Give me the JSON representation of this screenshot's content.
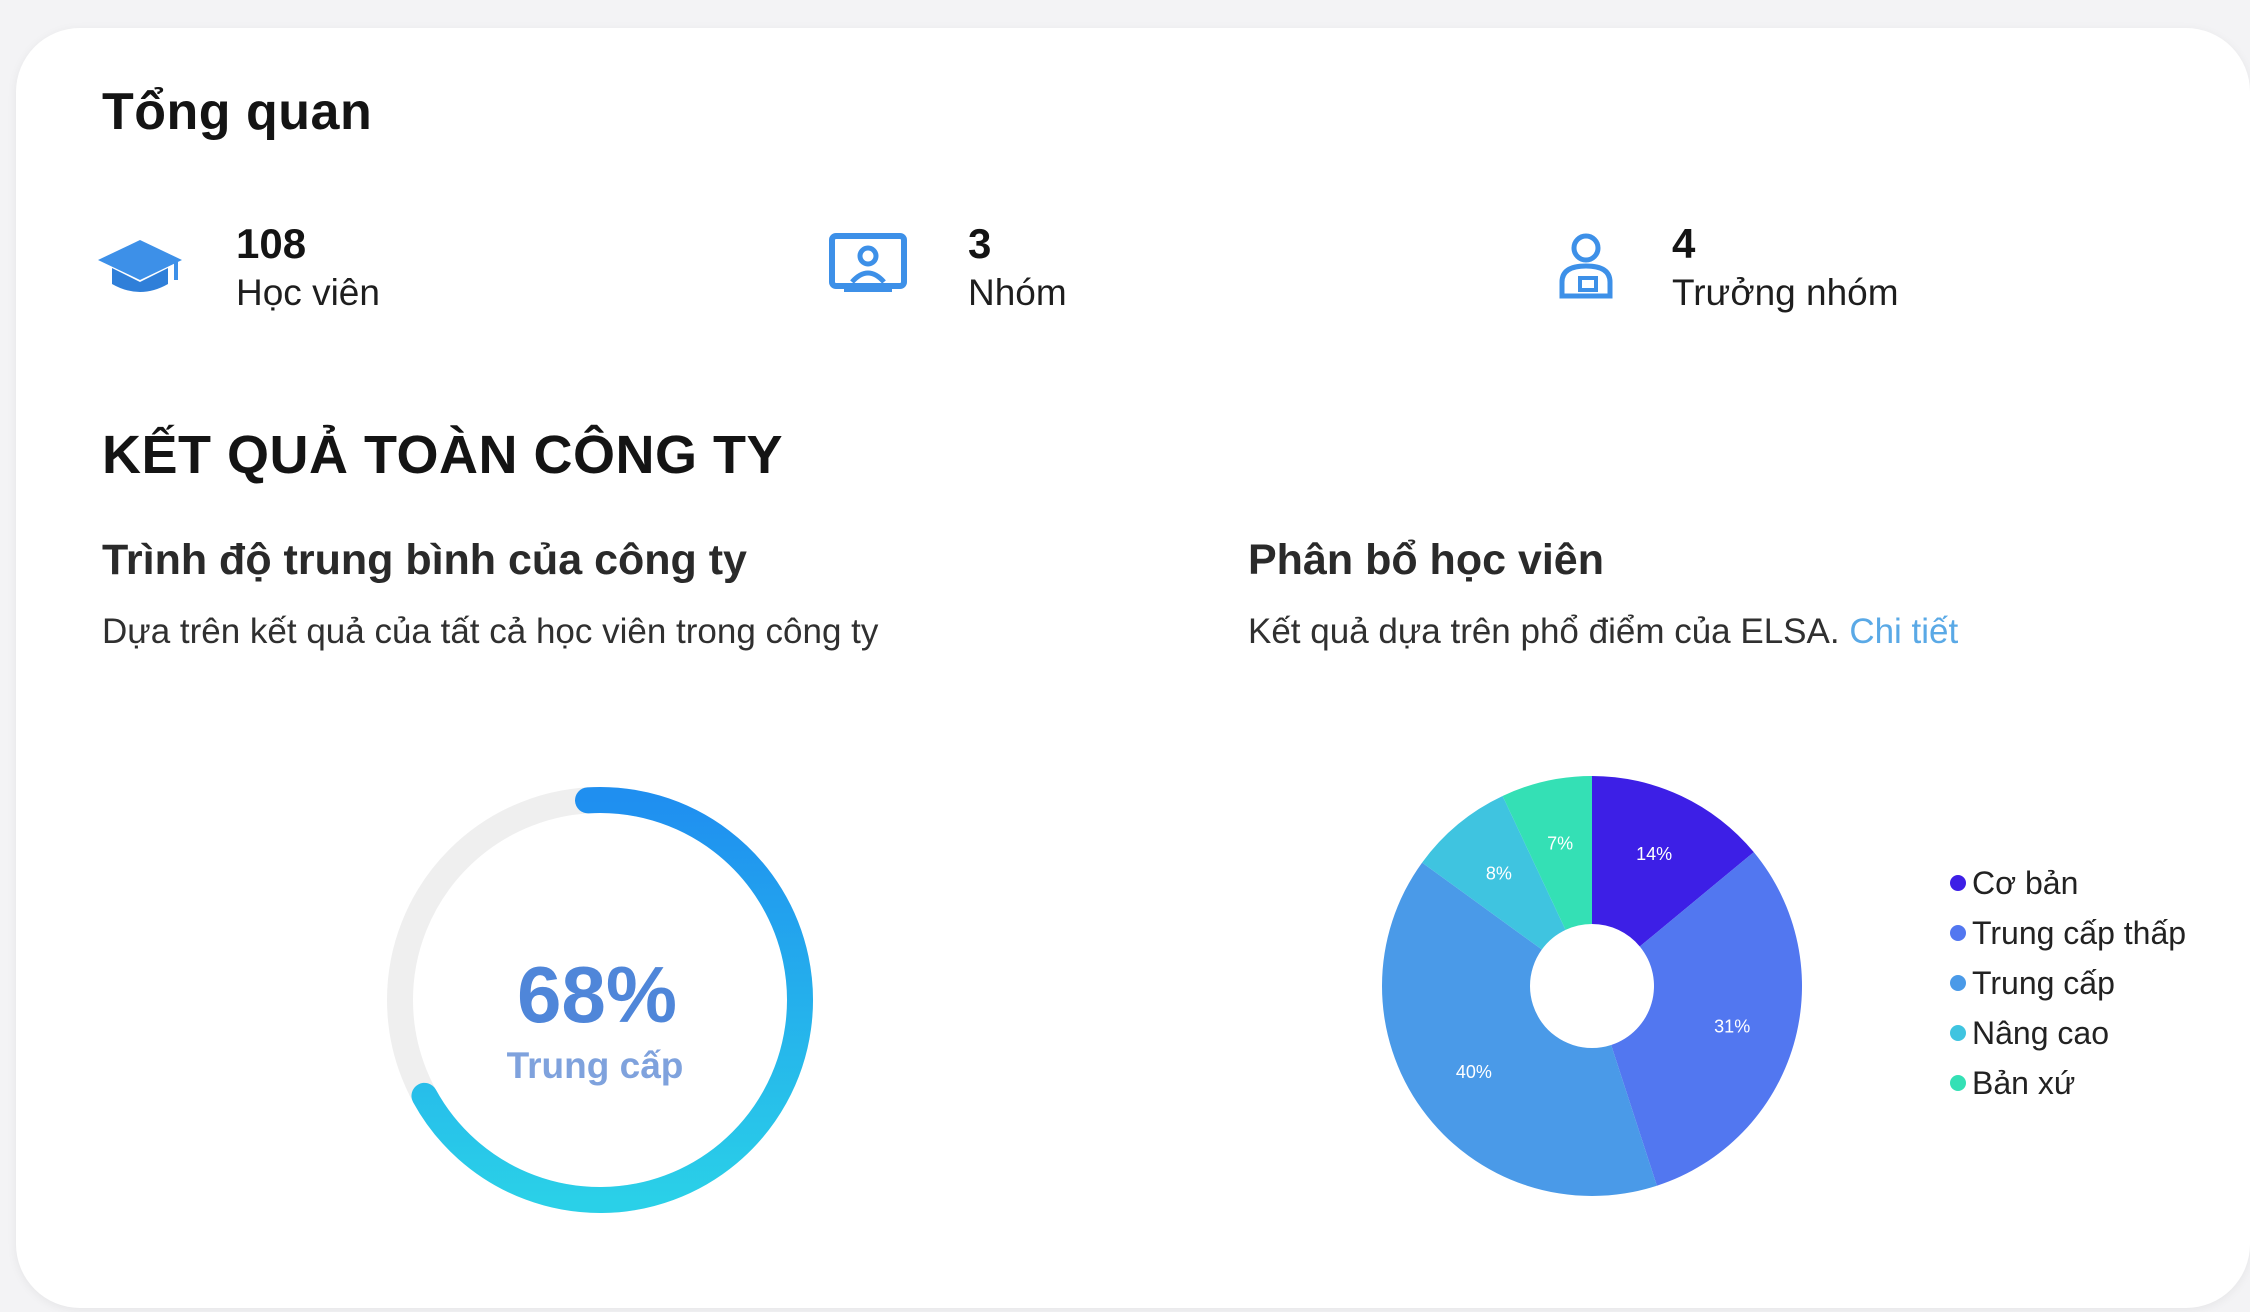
{
  "overview": {
    "title": "Tổng quan",
    "stats": [
      {
        "icon": "graduation-cap-icon",
        "value": "108",
        "label": "Học viên"
      },
      {
        "icon": "group-screen-icon",
        "value": "3",
        "label": "Nhóm"
      },
      {
        "icon": "team-leader-icon",
        "value": "4",
        "label": "Trưởng nhóm"
      }
    ]
  },
  "results": {
    "title": "KẾT QUẢ TOÀN CÔNG TY",
    "average": {
      "title": "Trình độ trung bình của công ty",
      "desc": "Dựa trên kết quả của tất cả học viên trong công ty",
      "percent_label": "68%",
      "percent": 68,
      "level": "Trung cấp"
    },
    "distribution": {
      "title": "Phân bổ học viên",
      "desc": "Kết quả dựa trên phổ điểm của ELSA. ",
      "link": "Chi tiết"
    }
  },
  "colors": {
    "accent": "#4f86d9",
    "gauge_start": "#2ad0e8",
    "gauge_end": "#1f8ff0",
    "gauge_track": "#efefef"
  },
  "chart_data": {
    "type": "pie",
    "categories": [
      "Cơ bản",
      "Trung cấp thấp",
      "Trung cấp",
      "Nâng cao",
      "Bản xứ"
    ],
    "values": [
      14,
      31,
      40,
      8,
      7
    ],
    "value_labels": [
      "14%",
      "31%",
      "40%",
      "8%",
      "7%"
    ],
    "colors": [
      "#3d1fe6",
      "#5277f0",
      "#4a9ae8",
      "#3fc4e0",
      "#34e0b5"
    ],
    "legend": "right"
  }
}
